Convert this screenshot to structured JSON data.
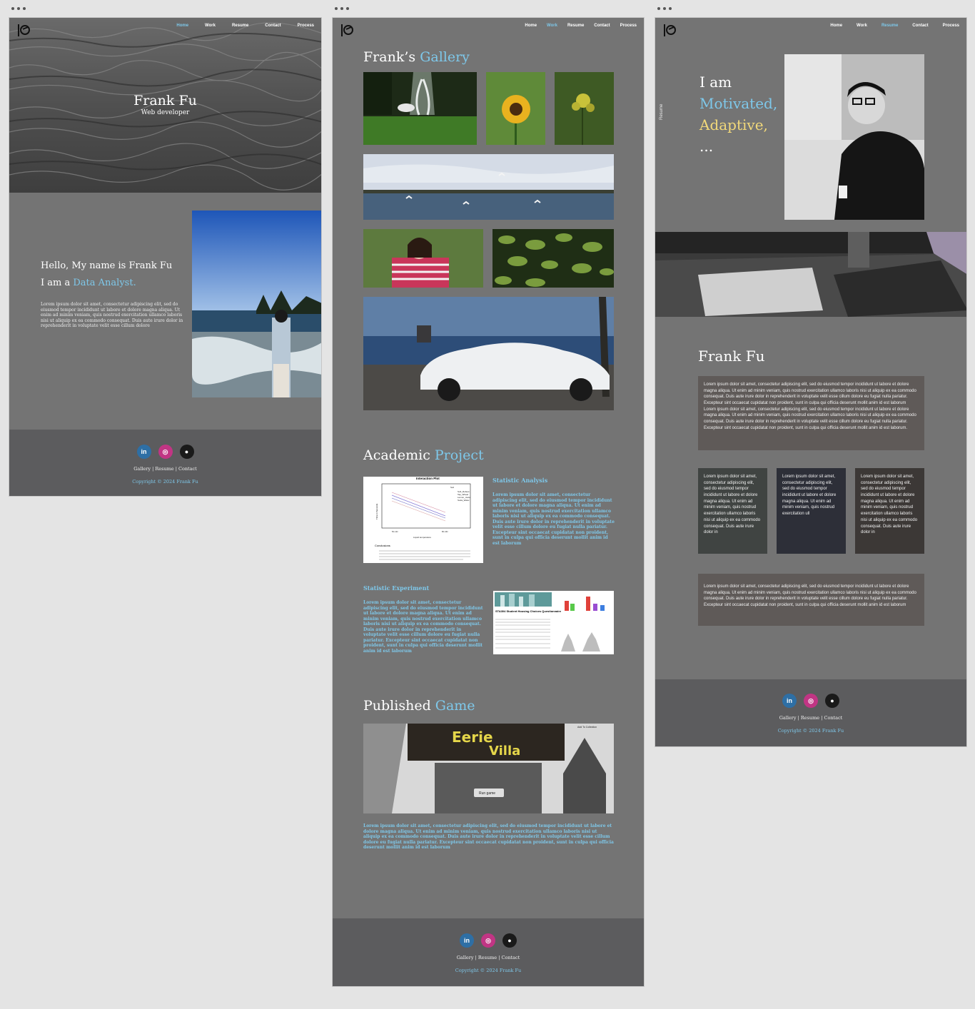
{
  "colors": {
    "accent": "#7ec8ea",
    "yellow": "#f2d97a",
    "page_bg": "#747474",
    "footer_bg": "#5c5c5e",
    "canvas_bg": "#e4e4e4"
  },
  "nav": {
    "items": [
      "Home",
      "Work",
      "Resume",
      "Contact",
      "Process"
    ]
  },
  "footer": {
    "linkedin_icon": "linkedin-icon",
    "instagram_icon": "instagram-icon",
    "github_icon": "github-icon",
    "links": "Gallery | Resume | Contact",
    "copyright": "Copyright © 2024 Frank Fu"
  },
  "home": {
    "hero_name": "Frank Fu",
    "hero_role": "Web developer",
    "intro_line1": "Hello, My name is Frank Fu",
    "intro_prefix": "I am a ",
    "intro_accent": "Data Analyst.",
    "intro_body": "Lorem ipsum dolor sit amet, consectetur adipiscing elit, sed do eiusmod tempor incididunt ut labore et dolore magna aliqua. Ut enim ad minim veniam, quis nostrud exercitation ullamco laboris nisi ut aliquip ex ea commodo consequat. Duis aute irure dolor in reprehenderit in voluptate velit esse cillum dolore"
  },
  "work": {
    "gallery_title": "Frank’s ",
    "gallery_accent": "Gallery",
    "academic_title": "Academic ",
    "academic_accent": "Project",
    "stat_analysis_title": "Statistic Analysis",
    "stat_analysis_body": "Lorem ipsum dolor sit amet, consectetur adipiscing elit, sed do eiusmod tempor incididunt ut labore et dolore magna aliqua. Ut enim ad minim veniam, quis nostrud exercitation ullamco laboris nisi ut aliquip ex ea commodo consequat. Duis aute irure dolor in reprehenderit in voluptate velit esse cillum dolore eu fugiat nulla pariatur. Excepteur sint occaecat cupidatat non proident, sunt in culpa qui officia deserunt mollit anim id est laborum",
    "chart_title": "Interaction Plot",
    "chart_xlabel": "Liquid temperature",
    "chart_ylabel": "Time in Seconds",
    "chart_legend": [
      "Soft_Robust",
      "Tap_Wheat",
      "Lemon_Juice",
      "Soda_Water"
    ],
    "chart_conclusion": "Conclusions",
    "stat_experiment_title": "Statistic Experiment",
    "stat_experiment_body": "Lorem ipsum dolor sit amet, consectetur adipiscing elit, sed do eiusmod tempor incididunt ut labore et dolore magna aliqua. Ut enim ad minim veniam, quis nostrud exercitation ullamco laboris nisi ut aliquip ex ea commodo consequat. Duis aute irure dolor in reprehenderit in voluptate velit esse cillum dolore eu fugiat nulla pariatur. Excepteur sint occaecat cupidatat non proident, sunt in culpa qui officia deserunt mollit anim id est laborum",
    "poster_title": "STA304 Student Housing Choices Questionnaire",
    "game_title": "Published ",
    "game_accent": "Game",
    "game_name": "Eerie Villa",
    "game_add": "Add To Collection",
    "game_run": "Run game",
    "game_body": "Lorem ipsum dolor sit amet, consectetur adipiscing elit, sed do eiusmod tempor incididunt ut labore et dolore magna aliqua. Ut enim ad minim veniam, quis nostrud exercitation ullamco laboris nisi ut aliquip ex ea commodo consequat. Duis aute irure dolor in reprehenderit in voluptate velit esse cillum dolore eu fugiat nulla pariatur. Excepteur sint occaecat cupidatat non proident, sunt in culpa qui officia deserunt mollit anim id est laborum"
  },
  "resume": {
    "side_label": "Resume",
    "line1": "I am",
    "line2": "Motivated,",
    "line3": "Adaptive,",
    "line4": "...",
    "name": "Frank Fu",
    "card_main": "Lorem ipsum dolor sit amet, consectetur adipiscing elit, sed do eiusmod tempor incididunt ut labore et dolore magna aliqua. Ut enim ad minim veniam, quis nostrud exercitation ullamco laboris nisi ut aliquip ex ea commodo consequat. Duis aute irure dolor in reprehenderit in voluptate velit esse cillum dolore eu fugiat nulla pariatur. Excepteur sint occaecat cupidatat non proident, sunt in culpa qui officia deserunt mollit anim id est laborum\nLorem ipsum dolor sit amet, consectetur adipiscing elit, sed do eiusmod tempor incididunt ut labore et dolore magna aliqua. Ut enim ad minim veniam, quis nostrud exercitation ullamco laboris nisi ut aliquip ex ea commodo consequat. Duis aute irure dolor in reprehenderit in voluptate velit esse cillum dolore eu fugiat nulla pariatur. Excepteur sint occaecat cupidatat non proident, sunt in culpa qui officia deserunt mollit anim id est laborum.",
    "card_a": "Lorem ipsum dolor sit amet, consectetur adipiscing elit, sed do eiusmod tempor incididunt ut labore et dolore magna aliqua. Ut enim ad minim veniam, quis nostrud exercitation ullamco laboris nisi ut aliquip ex ea commodo consequat. Duis aute irure dolor in",
    "card_b": "Lorem ipsum dolor sit amet, consectetur adipiscing elit, sed do eiusmod tempor incididunt ut labore et dolore magna aliqua. Ut enim ad minim veniam, quis nostrud exercitation ull",
    "card_c": "Lorem ipsum dolor sit amet, consectetur adipiscing elit, sed do eiusmod tempor incididunt ut labore et dolore magna aliqua. Ut enim ad minim veniam, quis nostrud exercitation ullamco laboris nisi ut aliquip ex ea commodo consequat. Duis aute irure dolor in",
    "card_bottom": "Lorem ipsum dolor sit amet, consectetur adipiscing elit, sed do eiusmod tempor incididunt ut labore et dolore magna aliqua. Ut enim ad minim veniam, quis nostrud exercitation ullamco laboris nisi ut aliquip ex ea commodo consequat. Duis aute irure dolor in reprehenderit in voluptate velit esse cillum dolore eu fugiat nulla pariatur. Excepteur sint occaecat cupidatat non proident, sunt in culpa qui officia deserunt mollit anim id est laborum"
  }
}
